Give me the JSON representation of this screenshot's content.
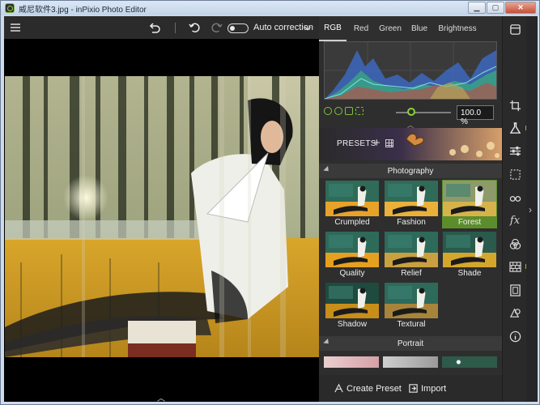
{
  "window": {
    "title": "威尼软件3.jpg - inPixio Photo Editor"
  },
  "toolbar": {
    "auto_correction_label": "Auto correction"
  },
  "histogram": {
    "tabs": [
      {
        "label": "RGB",
        "active": true
      },
      {
        "label": "Red",
        "active": false
      },
      {
        "label": "Green",
        "active": false
      },
      {
        "label": "Blue",
        "active": false
      },
      {
        "label": "Brightness",
        "active": false
      }
    ]
  },
  "zoom": {
    "value": "100.0 %"
  },
  "presets": {
    "label": "PRESETS"
  },
  "sections": {
    "photography": "Photography",
    "portrait": "Portrait"
  },
  "photography_presets": [
    {
      "label": "Crumpled",
      "selected": false
    },
    {
      "label": "Fashion",
      "selected": false
    },
    {
      "label": "Forest",
      "selected": true
    },
    {
      "label": "Quality",
      "selected": false
    },
    {
      "label": "Relief",
      "selected": false
    },
    {
      "label": "Shade",
      "selected": false
    },
    {
      "label": "Shadow",
      "selected": false
    },
    {
      "label": "Textural",
      "selected": false
    }
  ],
  "actions": {
    "create_preset": "Create Preset",
    "import": "Import"
  },
  "colors": {
    "accent": "#7fc23a",
    "selected_preset": "#5c8d2c",
    "panel": "#2e2e2e"
  },
  "rail_icons": [
    "layers-icon",
    "crop-icon",
    "flask-icon",
    "sliders-icon",
    "selection-icon",
    "glasses-icon",
    "fx-icon",
    "color-circles-icon",
    "texture-icon",
    "frame-icon",
    "shapes-icon",
    "info-icon"
  ]
}
